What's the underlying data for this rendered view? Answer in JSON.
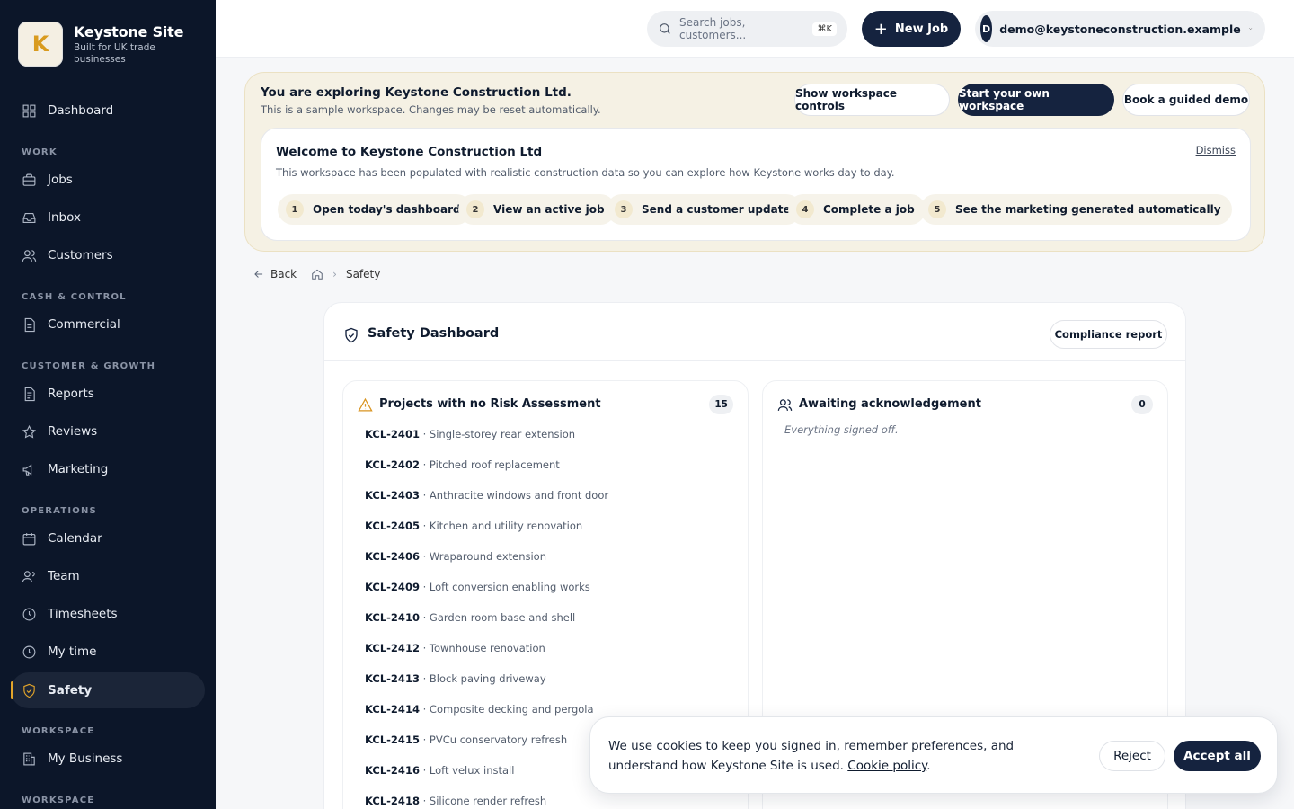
{
  "brand": {
    "name": "Keystone Site",
    "tagline": "Built for UK trade businesses",
    "logo_letter": "K"
  },
  "sidebar": {
    "dashboard": "Dashboard",
    "sections": [
      "WORK",
      "CASH & CONTROL",
      "CUSTOMER & GROWTH",
      "OPERATIONS",
      "WORKSPACE",
      "WORKSPACE"
    ],
    "items": [
      {
        "label": "Jobs",
        "icon": "briefcase-icon"
      },
      {
        "label": "Inbox",
        "icon": "inbox-icon"
      },
      {
        "label": "Customers",
        "icon": "users-icon"
      },
      {
        "label": "Commercial",
        "icon": "document-icon"
      },
      {
        "label": "Reports",
        "icon": "report-icon"
      },
      {
        "label": "Reviews",
        "icon": "star-icon"
      },
      {
        "label": "Marketing",
        "icon": "megaphone-icon"
      },
      {
        "label": "Calendar",
        "icon": "calendar-icon"
      },
      {
        "label": "Team",
        "icon": "team-icon"
      },
      {
        "label": "Timesheets",
        "icon": "clock-icon"
      },
      {
        "label": "My time",
        "icon": "clock-icon"
      },
      {
        "label": "Safety",
        "icon": "shield-icon",
        "active": true
      },
      {
        "label": "My Business",
        "icon": "building-icon"
      }
    ]
  },
  "topbar": {
    "search_placeholder": "Search jobs, customers...",
    "search_shortcut": "⌘K",
    "new_job": "New Job",
    "user_initial": "D",
    "user_email": "demo@keystoneconstruction.example"
  },
  "banner": {
    "title": "You are exploring Keystone Construction Ltd.",
    "subtitle": "This is a sample workspace. Changes may be reset automatically.",
    "show_controls": "Show workspace controls",
    "start_workspace": "Start your own workspace",
    "book_demo": "Book a guided demo",
    "welcome_title": "Welcome to Keystone Construction Ltd",
    "welcome_sub": "This workspace has been populated with realistic construction data so you can explore how Keystone works day to day.",
    "dismiss": "Dismiss",
    "steps": [
      {
        "n": "1",
        "label": "Open today's dashboard"
      },
      {
        "n": "2",
        "label": "View an active job"
      },
      {
        "n": "3",
        "label": "Send a customer update"
      },
      {
        "n": "4",
        "label": "Complete a job"
      },
      {
        "n": "5",
        "label": "See the marketing generated automatically"
      }
    ]
  },
  "breadcrumb": {
    "back": "Back",
    "current": "Safety"
  },
  "safety": {
    "title": "Safety Dashboard",
    "compliance_button": "Compliance report",
    "no_risk": {
      "title": "Projects with no Risk Assessment",
      "count": "15",
      "rows": [
        {
          "code": "KCL-2401",
          "name": "· Single-storey rear extension"
        },
        {
          "code": "KCL-2402",
          "name": "· Pitched roof replacement"
        },
        {
          "code": "KCL-2403",
          "name": "· Anthracite windows and front door"
        },
        {
          "code": "KCL-2405",
          "name": "· Kitchen and utility renovation"
        },
        {
          "code": "KCL-2406",
          "name": "· Wraparound extension"
        },
        {
          "code": "KCL-2409",
          "name": "· Loft conversion enabling works"
        },
        {
          "code": "KCL-2410",
          "name": "· Garden room base and shell"
        },
        {
          "code": "KCL-2412",
          "name": "· Townhouse renovation"
        },
        {
          "code": "KCL-2413",
          "name": "· Block paving driveway"
        },
        {
          "code": "KCL-2414",
          "name": "· Composite decking and pergola"
        },
        {
          "code": "KCL-2415",
          "name": "· PVCu conservatory refresh"
        },
        {
          "code": "KCL-2416",
          "name": "· Loft velux install"
        },
        {
          "code": "KCL-2418",
          "name": "· Silicone render refresh"
        }
      ]
    },
    "awaiting": {
      "title": "Awaiting acknowledgement",
      "count": "0",
      "empty": "Everything signed off."
    }
  },
  "cookie": {
    "text": "We use cookies to keep you signed in, remember preferences, and understand how Keystone Site is used.",
    "link": "Cookie policy",
    "reject": "Reject",
    "accept": "Accept all"
  },
  "colors": {
    "navy": "#0c1629",
    "accent": "#e3a52a",
    "button": "#15233f"
  }
}
